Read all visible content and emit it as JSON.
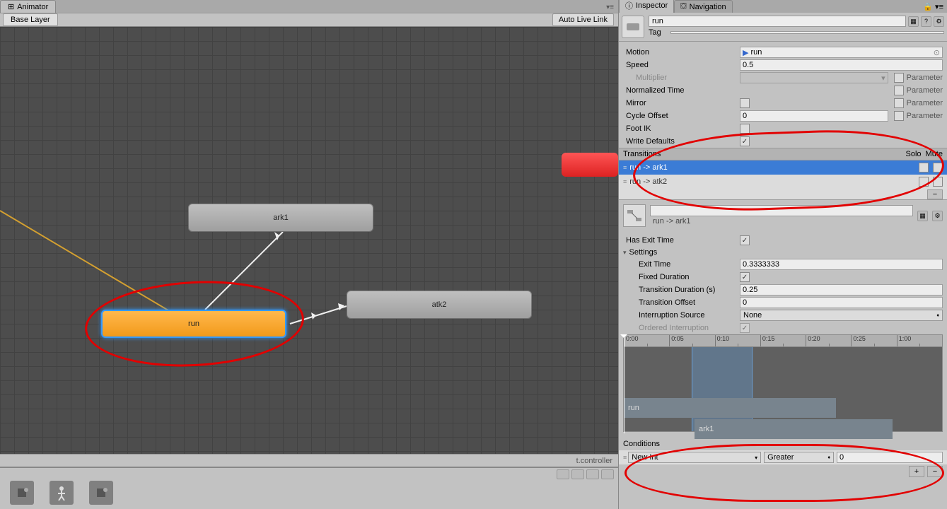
{
  "animator": {
    "tab_label": "Animator",
    "base_layer": "Base Layer",
    "live_link": "Auto Live Link",
    "status": "t.controller",
    "nodes": {
      "ark1": "ark1",
      "run": "run",
      "atk2": "atk2"
    }
  },
  "inspector": {
    "tab_inspector": "Inspector",
    "tab_navigation": "Navigation",
    "state_name": "run",
    "tag_label": "Tag",
    "motion_label": "Motion",
    "motion_value": "run",
    "speed_label": "Speed",
    "speed_value": "0.5",
    "multiplier_label": "Multiplier",
    "normtime_label": "Normalized Time",
    "mirror_label": "Mirror",
    "cycleoffset_label": "Cycle Offset",
    "cycleoffset_value": "0",
    "footik_label": "Foot IK",
    "writedefaults_label": "Write Defaults",
    "parameter_label": "Parameter",
    "transitions_label": "Transitions",
    "solo_label": "Solo",
    "mute_label": "Mute",
    "trans1": "run -> ark1",
    "trans2": "run -> atk2",
    "trans_selected": "run -> ark1",
    "has_exit_time": "Has Exit Time",
    "settings_label": "Settings",
    "exit_time_label": "Exit Time",
    "exit_time_value": "0.3333333",
    "fixed_duration_label": "Fixed Duration",
    "trans_duration_label": "Transition Duration (s)",
    "trans_duration_value": "0.25",
    "trans_offset_label": "Transition Offset",
    "trans_offset_value": "0",
    "interrupt_src_label": "Interruption Source",
    "interrupt_src_value": "None",
    "ordered_interrupt_label": "Ordered Interruption",
    "timeline_ticks": [
      "0:00",
      "0:05",
      "0:10",
      "0:15",
      "0:20",
      "0:25",
      "1:00"
    ],
    "timeline_run": "run",
    "timeline_ark1": "ark1",
    "conditions_label": "Conditions",
    "cond_param": "New Int",
    "cond_op": "Greater",
    "cond_value": "0"
  }
}
